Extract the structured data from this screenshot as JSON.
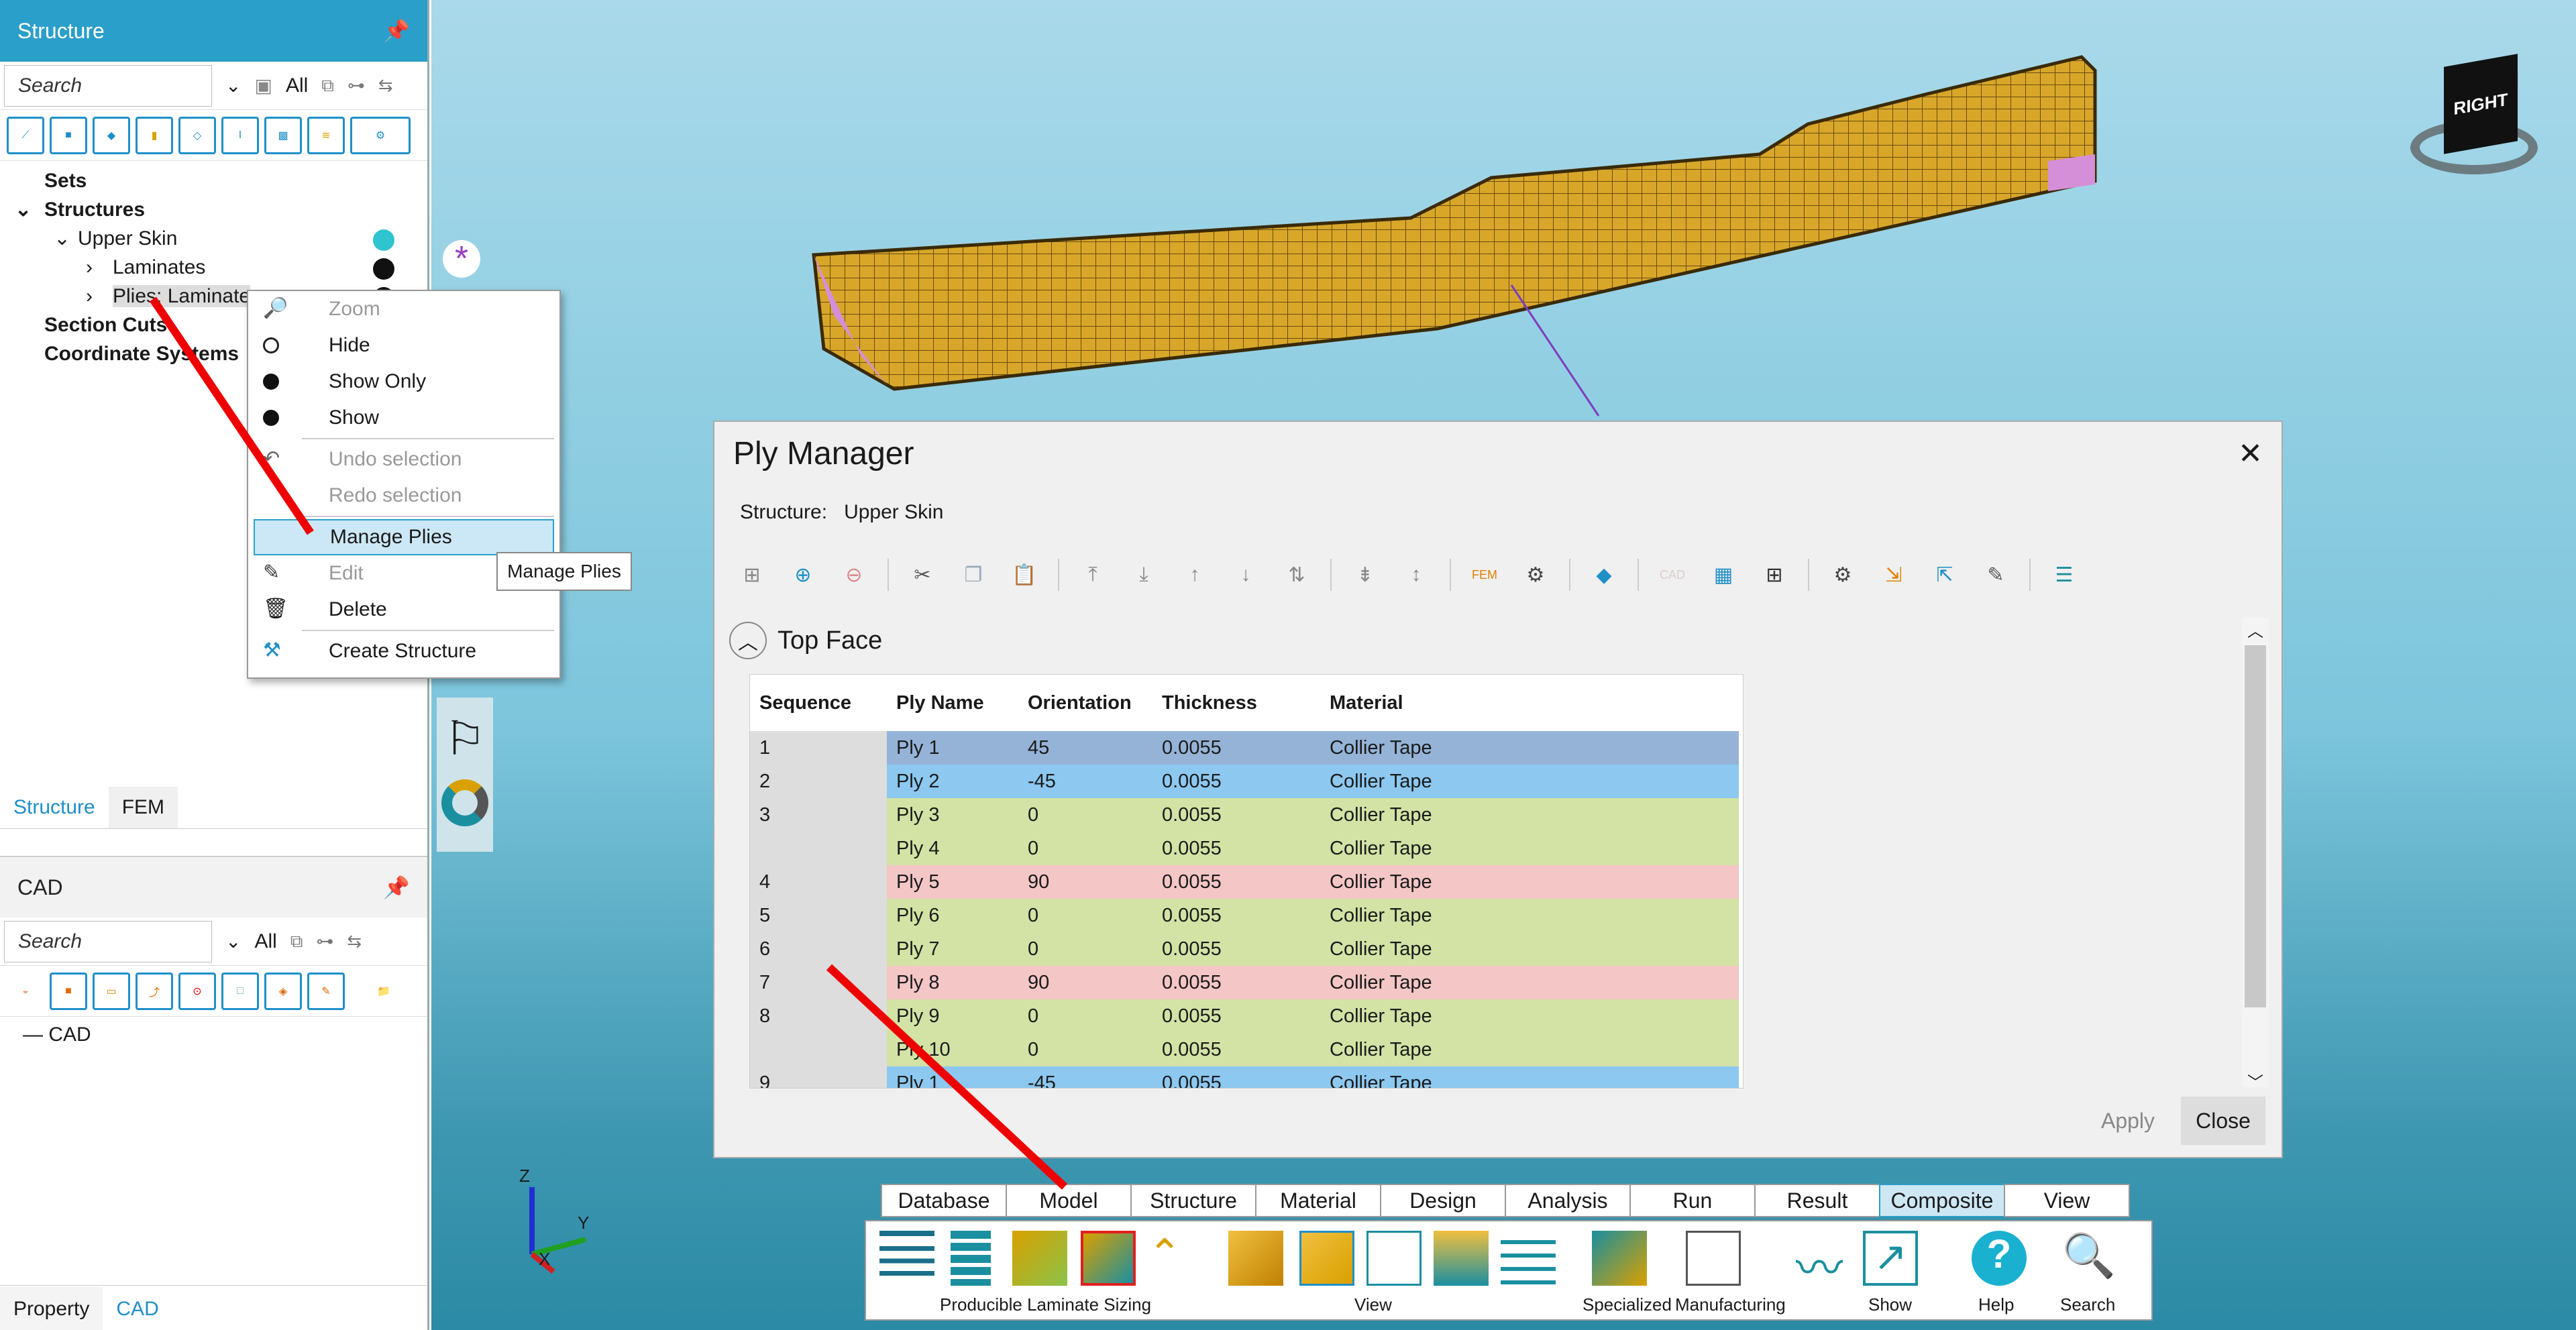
{
  "structure_panel": {
    "title": "Structure",
    "search_placeholder": "Search",
    "all_label": "All",
    "tree": {
      "sets": "Sets",
      "structures": "Structures",
      "upper_skin": "Upper Skin",
      "laminates": "Laminates",
      "plies": "Plies: Laminate",
      "section_cuts": "Section Cuts",
      "coordinate_systems": "Coordinate Systems"
    },
    "tabs": [
      "Structure",
      "FEM"
    ]
  },
  "cad_panel": {
    "title": "CAD",
    "search_placeholder": "Search",
    "all_label": "All",
    "tree_root": "CAD"
  },
  "bottom_tabs": [
    "Property",
    "CAD"
  ],
  "context_menu": {
    "items": [
      "Zoom",
      "Hide",
      "Show Only",
      "Show",
      "Undo selection",
      "Redo selection",
      "Manage Plies",
      "Edit",
      "Delete",
      "Create Structure"
    ]
  },
  "tooltip": "Manage Plies",
  "ply_manager": {
    "title": "Ply Manager",
    "structure_label": "Structure:",
    "structure_value": "Upper Skin",
    "section": "Top Face",
    "columns": [
      "Sequence",
      "Ply Name",
      "Orientation",
      "Thickness",
      "Material"
    ],
    "rows": [
      {
        "seq": "1",
        "name": "Ply 1",
        "orient": "45",
        "thick": "0.0055",
        "mat": "Collier Tape",
        "color": "#95b3d7"
      },
      {
        "seq": "2",
        "name": "Ply 2",
        "orient": "-45",
        "thick": "0.0055",
        "mat": "Collier Tape",
        "color": "#8cc8f0"
      },
      {
        "seq": "3",
        "name": "Ply 3",
        "orient": "0",
        "thick": "0.0055",
        "mat": "Collier Tape",
        "color": "#d2e3a5"
      },
      {
        "seq": "",
        "name": "Ply 4",
        "orient": "0",
        "thick": "0.0055",
        "mat": "Collier Tape",
        "color": "#d2e3a5"
      },
      {
        "seq": "4",
        "name": "Ply 5",
        "orient": "90",
        "thick": "0.0055",
        "mat": "Collier Tape",
        "color": "#f4c6c6"
      },
      {
        "seq": "5",
        "name": "Ply 6",
        "orient": "0",
        "thick": "0.0055",
        "mat": "Collier Tape",
        "color": "#d2e3a5"
      },
      {
        "seq": "6",
        "name": "Ply 7",
        "orient": "0",
        "thick": "0.0055",
        "mat": "Collier Tape",
        "color": "#d2e3a5"
      },
      {
        "seq": "7",
        "name": "Ply 8",
        "orient": "90",
        "thick": "0.0055",
        "mat": "Collier Tape",
        "color": "#f4c6c6"
      },
      {
        "seq": "8",
        "name": "Ply 9",
        "orient": "0",
        "thick": "0.0055",
        "mat": "Collier Tape",
        "color": "#d2e3a5"
      },
      {
        "seq": "",
        "name": "Ply 10",
        "orient": "0",
        "thick": "0.0055",
        "mat": "Collier Tape",
        "color": "#d2e3a5"
      },
      {
        "seq": "9",
        "name": "Ply 1",
        "orient": "-45",
        "thick": "0.0055",
        "mat": "Collier Tape",
        "color": "#8cc8f0"
      }
    ],
    "apply": "Apply",
    "close": "Close"
  },
  "ribbon": {
    "tabs": [
      "Database",
      "Model",
      "Structure",
      "Material",
      "Design",
      "Analysis",
      "Run",
      "Result",
      "Composite",
      "View"
    ],
    "active": "Composite",
    "groups": [
      "Producible Laminate Sizing",
      "View",
      "Specialized",
      "Manufacturing",
      "Show",
      "Help",
      "Search"
    ]
  },
  "viewcube": {
    "label": "RIGHT"
  },
  "axes": {
    "x": "X",
    "y": "Y",
    "z": "Z"
  }
}
